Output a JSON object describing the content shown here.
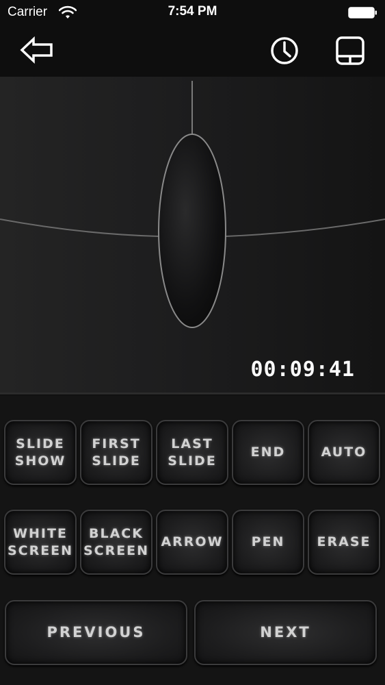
{
  "status_bar": {
    "carrier": "Carrier",
    "time": "7:54 PM"
  },
  "nav": {
    "back_icon": "back-arrow-icon",
    "history_icon": "clock-icon",
    "layout_icon": "touchpad-layout-icon"
  },
  "presentation": {
    "timer": "00:09:41"
  },
  "controls": {
    "row1": [
      "SLIDE\nSHOW",
      "FIRST\nSLIDE",
      "LAST\nSLIDE",
      "END",
      "AUTO"
    ],
    "row2": [
      "WHITE\nSCREEN",
      "BLACK\nSCREEN",
      "ARROW",
      "PEN",
      "ERASE"
    ],
    "previous": "PREVIOUS",
    "next": "NEXT"
  },
  "colors": {
    "background": "#141414",
    "button_border": "#3b3b3c",
    "button_text": "#d2d2d2"
  }
}
